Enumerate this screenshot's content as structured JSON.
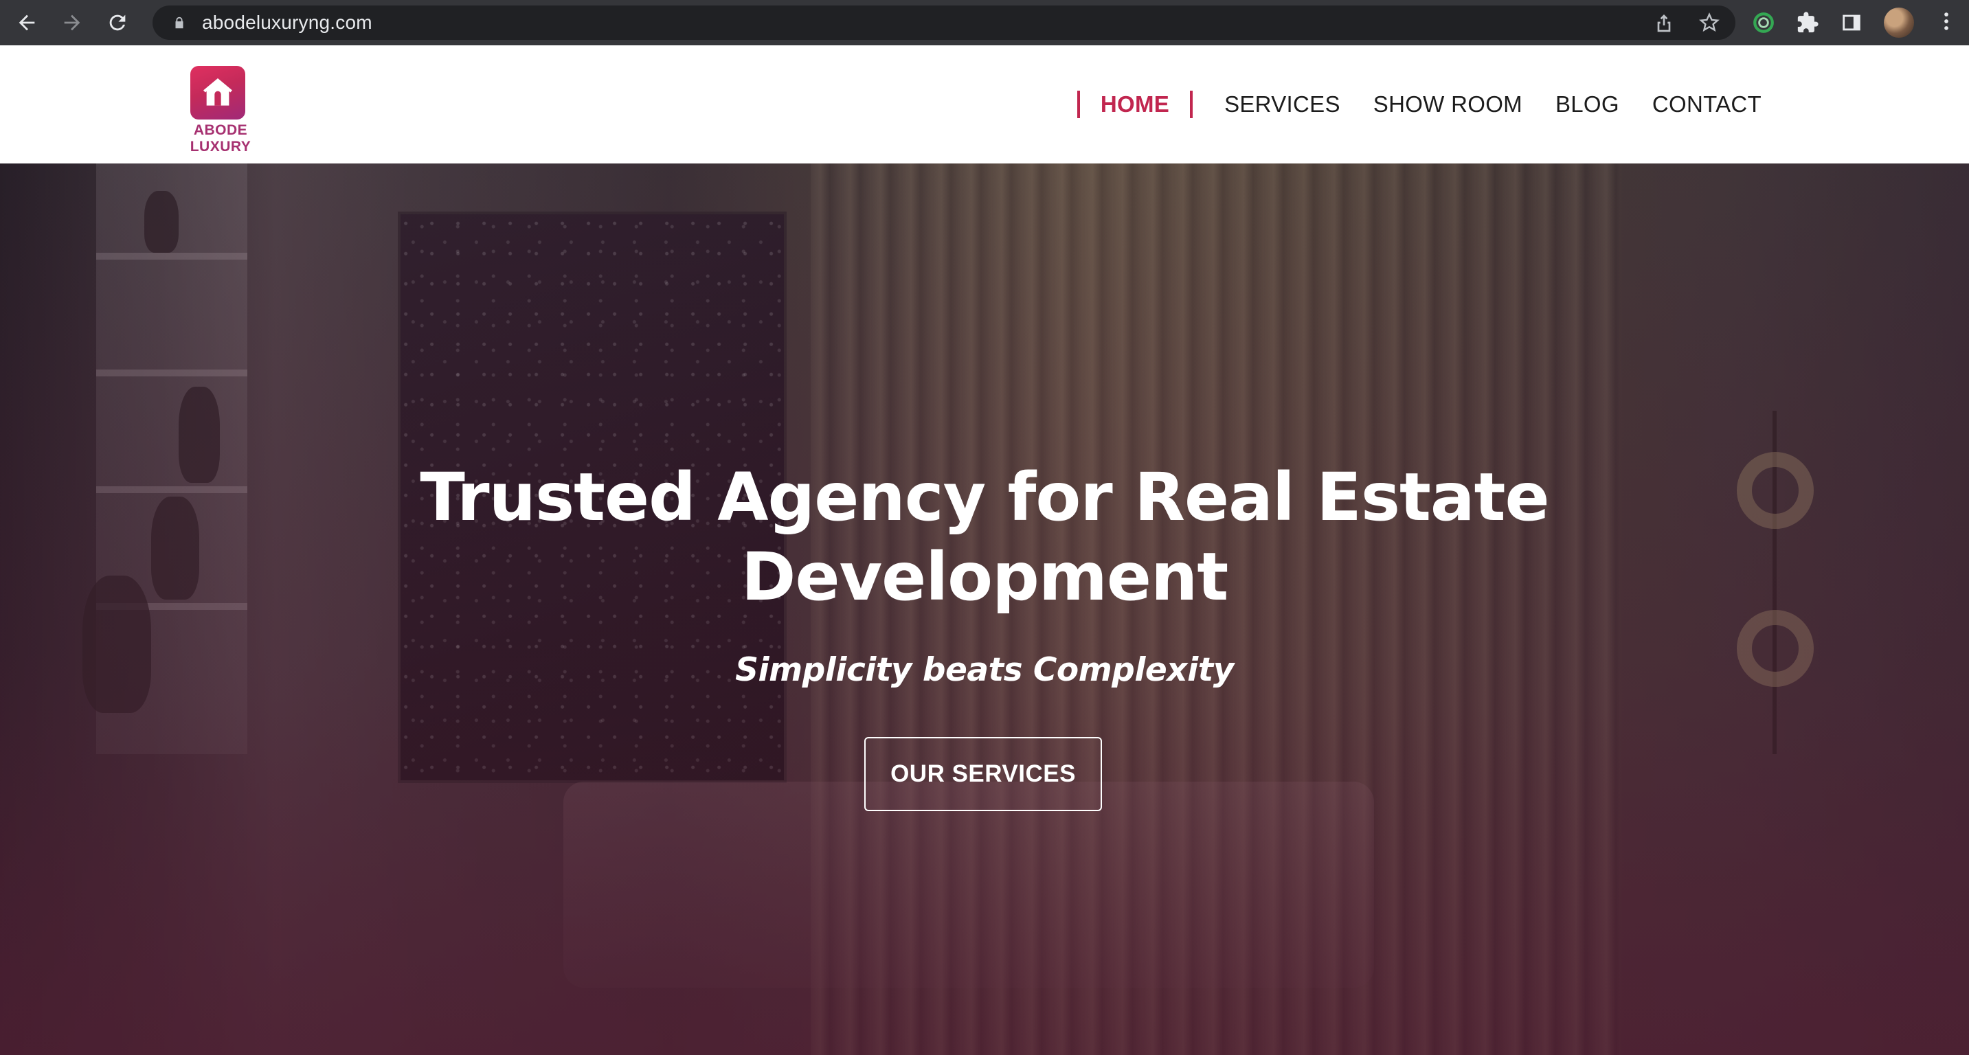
{
  "browser": {
    "url": "abodeluxuryng.com",
    "icons": [
      "back-arrow-icon",
      "forward-arrow-icon",
      "reload-icon",
      "lock-icon",
      "share-icon",
      "star-icon",
      "extension-ring-icon",
      "puzzle-icon",
      "side-panel-icon",
      "avatar",
      "more-vert-icon"
    ]
  },
  "header": {
    "logo_text": "ABODE LUXURY",
    "nav": {
      "home": "HOME",
      "services": "SERVICES",
      "showroom": "SHOW ROOM",
      "blog": "BLOG",
      "contact": "CONTACT"
    },
    "colors": {
      "accent": "#c1264f",
      "logo_gradient_start": "#e03060",
      "logo_gradient_end": "#a02a78"
    }
  },
  "hero": {
    "title_line1": "Trusted Agency for Real Estate",
    "title_line2": "Development",
    "subtitle": "Simplicity beats Complexity",
    "cta_label": "OUR SERVICES"
  }
}
